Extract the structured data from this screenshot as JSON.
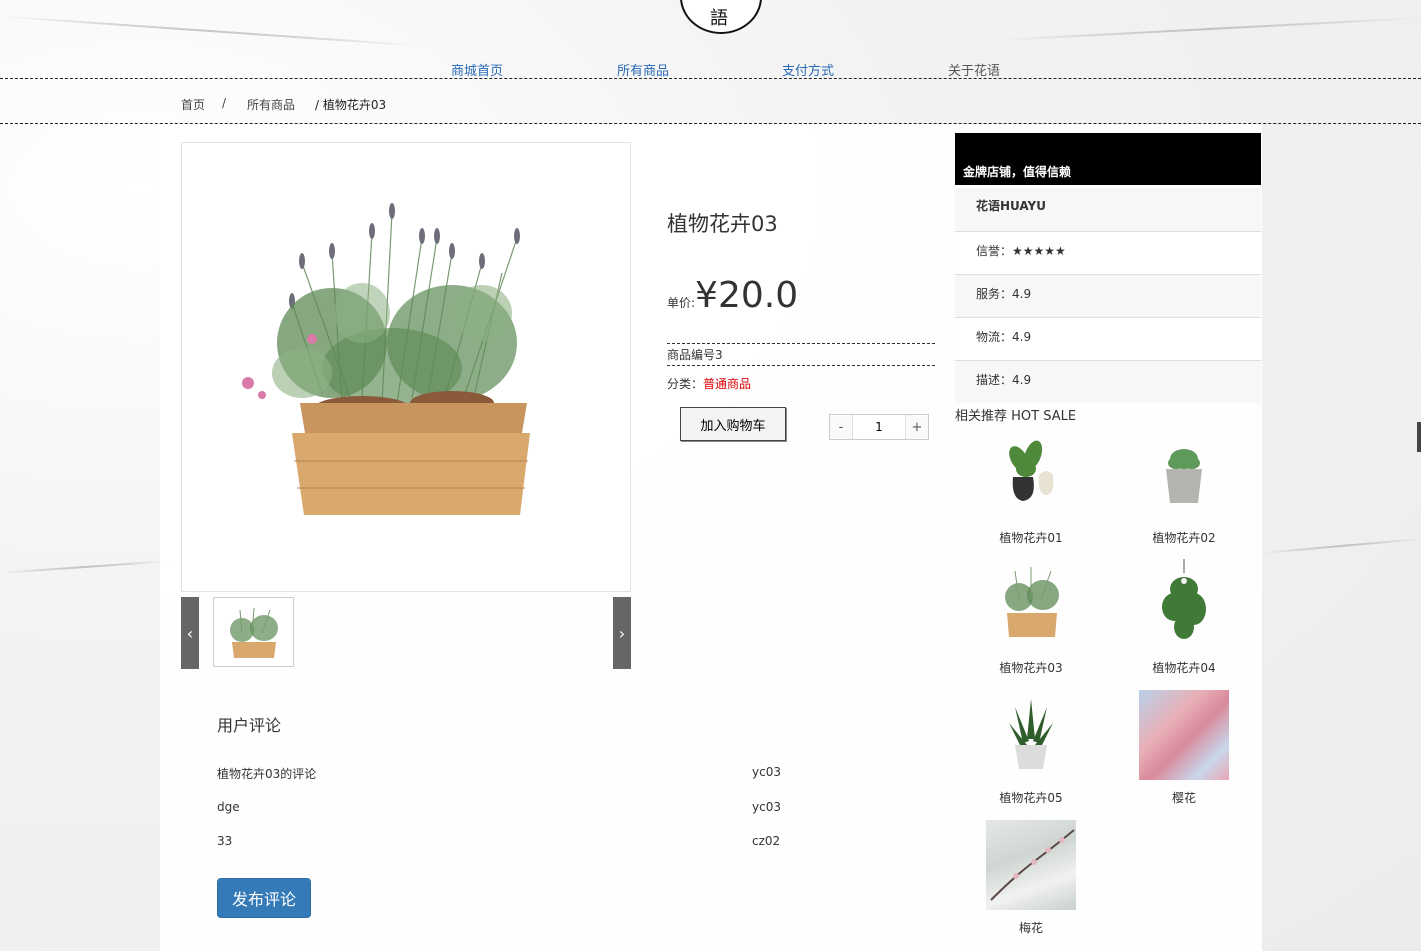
{
  "logo": {
    "char": "語"
  },
  "nav": {
    "home": "商城首页",
    "all": "所有商品",
    "pay": "支付方式",
    "about": "关于花语"
  },
  "breadcrumb": {
    "home": "首页",
    "sep1": "/",
    "all": "所有商品",
    "current": "/ 植物花卉03"
  },
  "product": {
    "name": "植物花卉03",
    "price_label": "单价:",
    "price": "¥20.0",
    "sku": "商品编号3",
    "category_label": "分类：",
    "category": "普通商品",
    "add_to_cart": "加入购物车",
    "qty_minus": "-",
    "qty_value": "1",
    "qty_plus": "+"
  },
  "reviews": {
    "title": "用户评论",
    "items": [
      {
        "text": "植物花卉03的评论",
        "user": "yc03"
      },
      {
        "text": "dge",
        "user": "yc03"
      },
      {
        "text": "33",
        "user": "cz02"
      }
    ],
    "publish": "发布评论"
  },
  "shop": {
    "banner": "金牌店铺，值得信赖",
    "name": "花语HUAYU",
    "reputation": "信誉：★★★★★",
    "service": "服务：4.9",
    "logistics": "物流：4.9",
    "description": "描述：4.9"
  },
  "hot": {
    "title": "相关推荐 HOT SALE",
    "items": [
      {
        "name": "植物花卉01"
      },
      {
        "name": "植物花卉02"
      },
      {
        "name": "植物花卉03"
      },
      {
        "name": "植物花卉04"
      },
      {
        "name": "植物花卉05"
      },
      {
        "name": "樱花"
      },
      {
        "name": "梅花"
      }
    ]
  },
  "colors": {
    "nav_active": "#2a6ab5",
    "price_red": "#dd0000",
    "publish_blue": "#337ab7"
  }
}
